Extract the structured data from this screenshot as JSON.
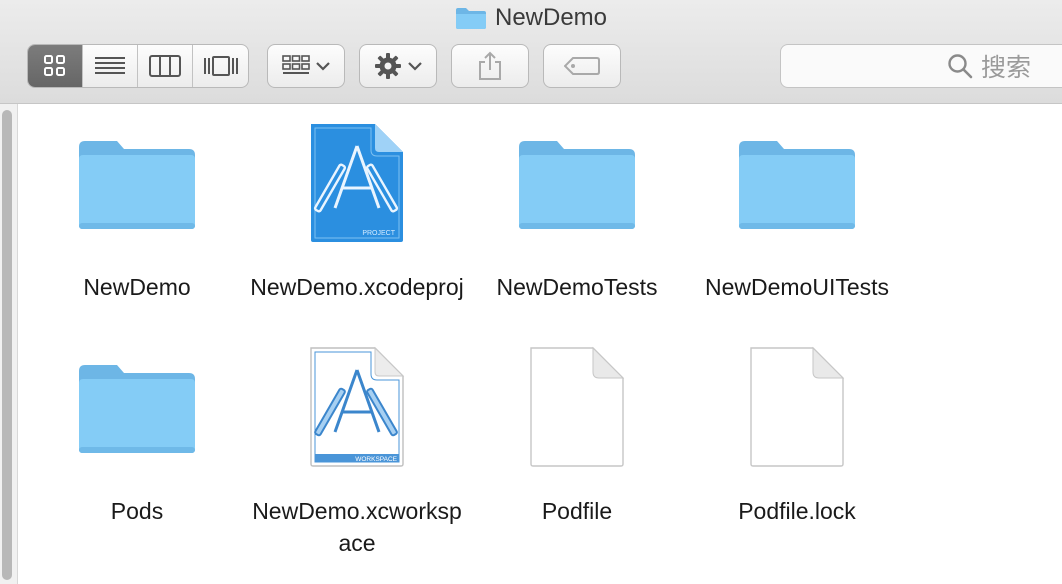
{
  "window": {
    "title": "NewDemo"
  },
  "toolbar": {
    "view_modes": [
      {
        "name": "icon-view",
        "active": true
      },
      {
        "name": "list-view",
        "active": false
      },
      {
        "name": "column-view",
        "active": false
      },
      {
        "name": "cover-flow-view",
        "active": false
      }
    ],
    "search_placeholder": "搜索"
  },
  "files": [
    {
      "name": "NewDemo",
      "kind": "folder"
    },
    {
      "name": "NewDemo.xcodeproj",
      "kind": "xcodeproj",
      "badge": "PROJECT"
    },
    {
      "name": "NewDemoTests",
      "kind": "folder"
    },
    {
      "name": "NewDemoUITests",
      "kind": "folder"
    },
    {
      "name": "Pods",
      "kind": "folder"
    },
    {
      "name": "NewDemo.xcworkspace",
      "kind": "xcworkspace",
      "badge": "WORKSPACE"
    },
    {
      "name": "Podfile",
      "kind": "document"
    },
    {
      "name": "Podfile.lock",
      "kind": "document"
    }
  ],
  "colors": {
    "folder": "#7fc7f3",
    "folder_tab": "#6db6e6",
    "xcode_blue": "#2b8fe0",
    "toolbar_bg": "#e4e4e4"
  }
}
